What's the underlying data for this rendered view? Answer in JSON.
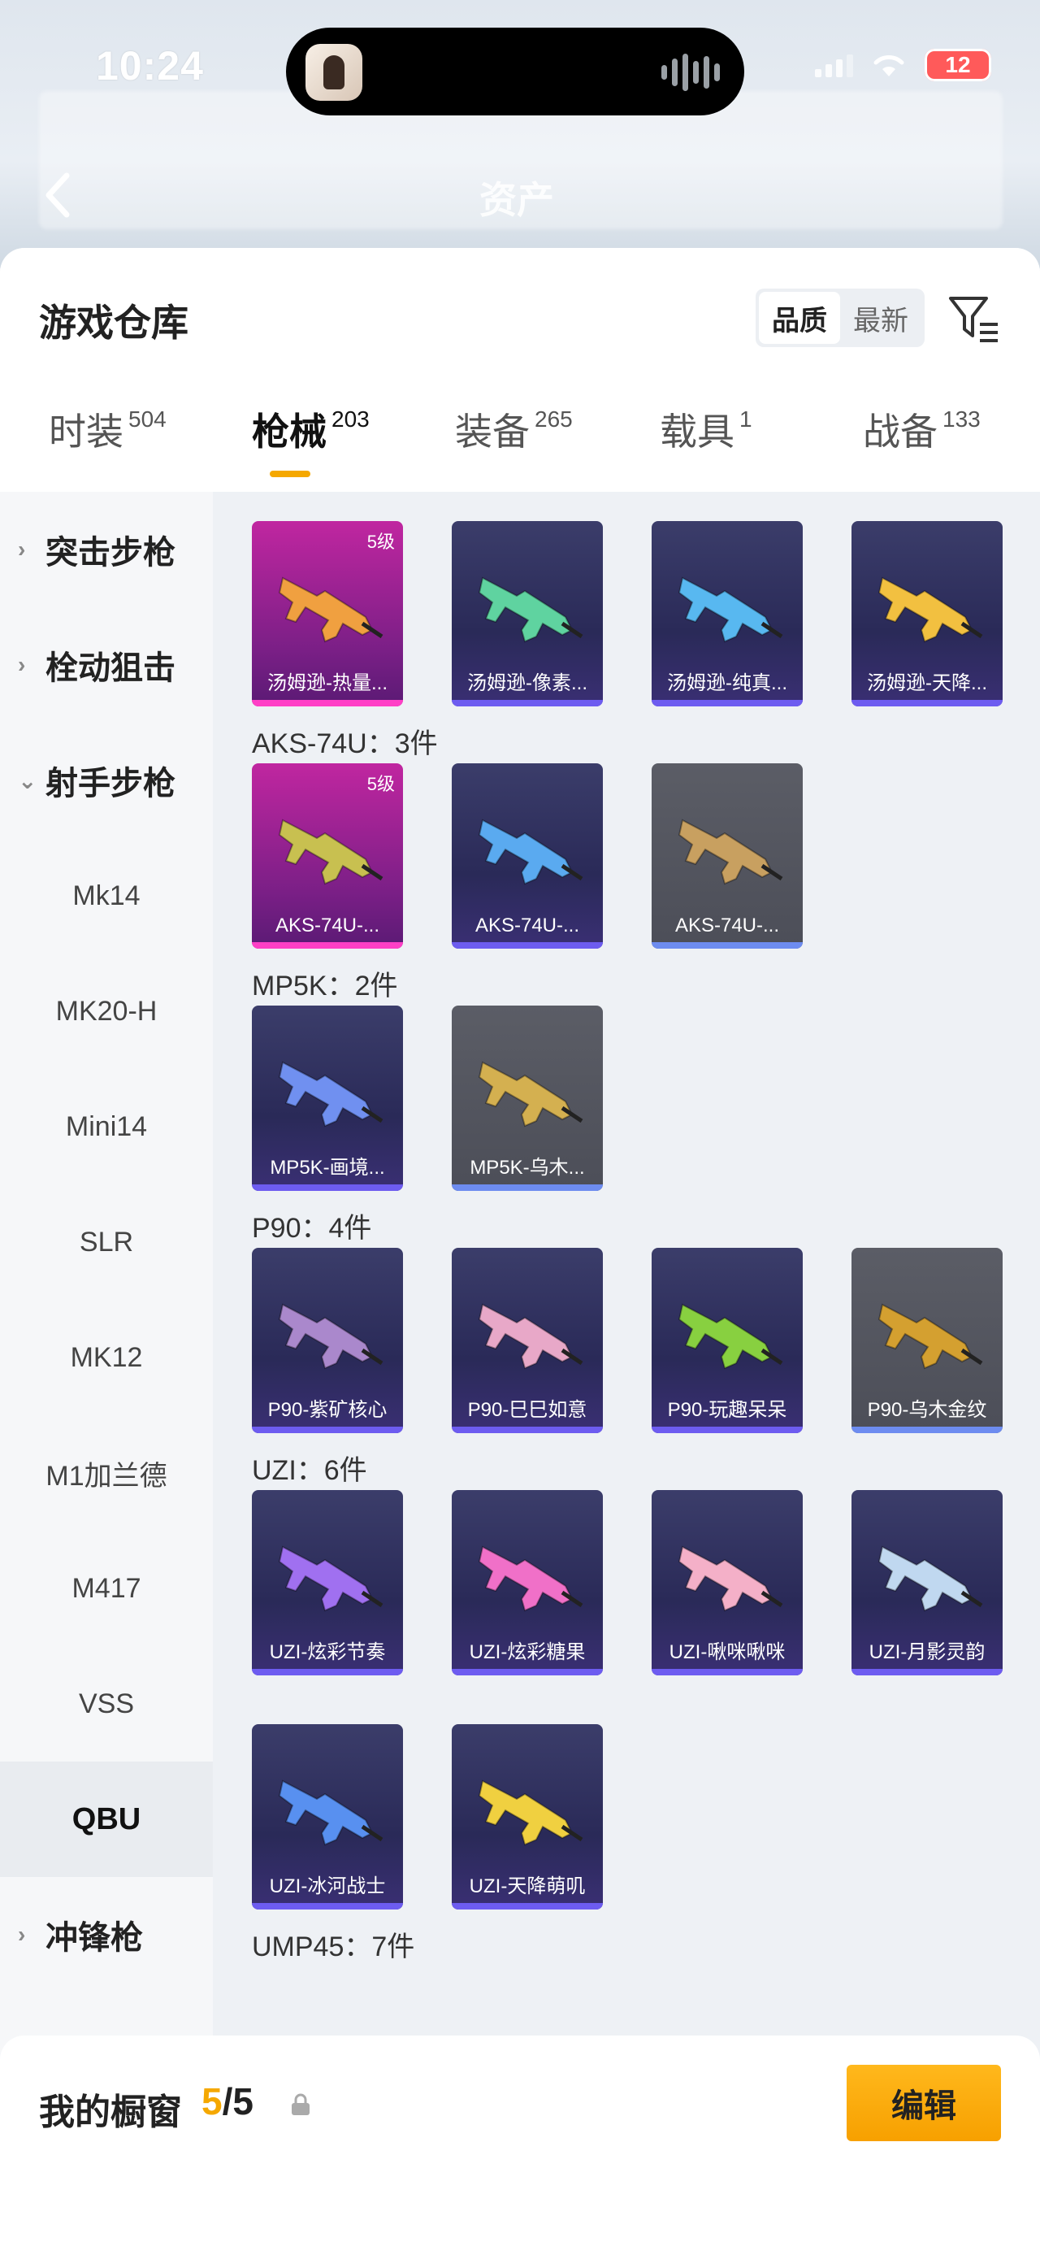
{
  "status_bar": {
    "time": "10:24",
    "battery": "12"
  },
  "nav": {
    "title": "资产"
  },
  "warehouse": {
    "title": "游戏仓库",
    "sort_options": [
      "品质",
      "最新"
    ],
    "sort_selected": "品质"
  },
  "tabs": [
    {
      "label": "时装",
      "count": "504"
    },
    {
      "label": "枪械",
      "count": "203"
    },
    {
      "label": "装备",
      "count": "265"
    },
    {
      "label": "载具",
      "count": "1"
    },
    {
      "label": "战备",
      "count": "133"
    }
  ],
  "active_tab": "枪械",
  "sidebar": {
    "categories": [
      {
        "label": "突击步枪",
        "arrow": "chevron-right"
      },
      {
        "label": "栓动狙击",
        "arrow": "chevron-right"
      },
      {
        "label": "射手步枪",
        "arrow": "chevron-down"
      },
      {
        "label": "冲锋枪",
        "arrow": "chevron-right"
      }
    ],
    "subitems": [
      "Mk14",
      "MK20-H",
      "Mini14",
      "SLR",
      "MK12",
      "M1加兰德",
      "M417",
      "VSS",
      "QBU"
    ],
    "selected": "QBU"
  },
  "groups": [
    {
      "label": "",
      "items": [
        {
          "name": "汤姆逊-热量...",
          "level": "5级",
          "rarity": "pink",
          "color": "#f0a040"
        },
        {
          "name": "汤姆逊-像素...",
          "level": "",
          "rarity": "purple",
          "color": "#5fd3a0"
        },
        {
          "name": "汤姆逊-纯真...",
          "level": "",
          "rarity": "purple",
          "color": "#58b8f0"
        },
        {
          "name": "汤姆逊-天降...",
          "level": "",
          "rarity": "purple",
          "color": "#f2c040"
        }
      ]
    },
    {
      "label": "AKS-74U：3件",
      "items": [
        {
          "name": "AKS-74U-...",
          "level": "5级",
          "rarity": "pink",
          "color": "#c8c050"
        },
        {
          "name": "AKS-74U-...",
          "level": "",
          "rarity": "purple",
          "color": "#5aaaf0"
        },
        {
          "name": "AKS-74U-...",
          "level": "",
          "rarity": "gray",
          "color": "#c8a060"
        }
      ]
    },
    {
      "label": "MP5K：2件",
      "items": [
        {
          "name": "MP5K-画境...",
          "level": "",
          "rarity": "purple",
          "color": "#7090f0"
        },
        {
          "name": "MP5K-乌木...",
          "level": "",
          "rarity": "gray",
          "color": "#d4b050"
        }
      ]
    },
    {
      "label": "P90：4件",
      "items": [
        {
          "name": "P90-紫矿核心",
          "level": "",
          "rarity": "purple",
          "color": "#aa88cc"
        },
        {
          "name": "P90-巳巳如意",
          "level": "",
          "rarity": "purple",
          "color": "#e8a8c8"
        },
        {
          "name": "P90-玩趣呆呆",
          "level": "",
          "rarity": "purple",
          "color": "#88d040"
        },
        {
          "name": "P90-乌木金纹",
          "level": "",
          "rarity": "gray",
          "color": "#d4a030"
        }
      ]
    },
    {
      "label": "UZI：6件",
      "items": [
        {
          "name": "UZI-炫彩节奏",
          "level": "",
          "rarity": "purple",
          "color": "#a070f0"
        },
        {
          "name": "UZI-炫彩糖果",
          "level": "",
          "rarity": "purple",
          "color": "#f070c8"
        },
        {
          "name": "UZI-啾咪啾咪",
          "level": "",
          "rarity": "purple",
          "color": "#f4b0c8"
        },
        {
          "name": "UZI-月影灵韵",
          "level": "",
          "rarity": "purple",
          "color": "#c0d8f0"
        },
        {
          "name": "UZI-冰河战士",
          "level": "",
          "rarity": "purple",
          "color": "#5890f0"
        },
        {
          "name": "UZI-天降萌叽",
          "level": "",
          "rarity": "purple",
          "color": "#f0d040"
        }
      ]
    },
    {
      "label": "UMP45：7件",
      "items": []
    }
  ],
  "showcase": {
    "title": "我的橱窗",
    "current": "5",
    "total": "5",
    "edit_label": "编辑"
  },
  "icons": {
    "back": "chevron-left-icon",
    "filter": "filter-icon",
    "share": "share-icon",
    "lock": "lock-icon"
  },
  "colors": {
    "accent": "#f5a800",
    "card_pink": "#c026a0",
    "card_purple": "#2a2a58",
    "card_gray": "#55575f"
  }
}
